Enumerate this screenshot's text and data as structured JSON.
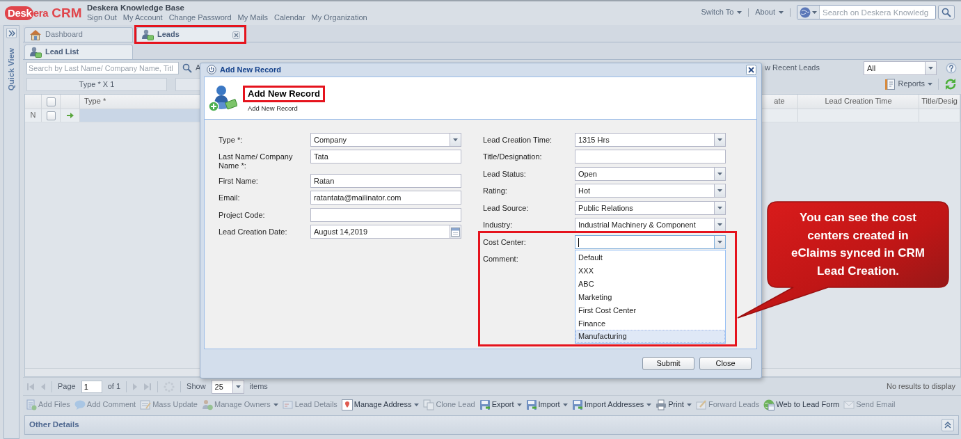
{
  "header": {
    "logo": {
      "mark_text": "Desk",
      "rest_text": "era",
      "product": "CRM"
    },
    "app_title": "Deskera Knowledge Base",
    "links": [
      "Sign Out",
      "My Account",
      "Change Password",
      "My Mails",
      "Calendar",
      "My Organization"
    ],
    "menus": [
      "Switch To",
      "About"
    ],
    "search": {
      "placeholder": "Search on Deskera Knowledg"
    }
  },
  "quick_view": {
    "label": "Quick View"
  },
  "main_tabs": [
    {
      "label": "Dashboard",
      "selected": false,
      "closable": false,
      "highlighted": false
    },
    {
      "label": "Leads",
      "selected": true,
      "closable": true,
      "highlighted": true
    }
  ],
  "sub_tabs": [
    {
      "label": "Lead List",
      "selected": true
    }
  ],
  "list_toolbar": {
    "search_placeholder": "Search by Last Name/ Company Name, Titl",
    "cut_button": "A",
    "recent_button": "w Recent Leads",
    "recent_filter": "All"
  },
  "group_bar": {
    "group_label": "Type * X 1",
    "reports": "Reports"
  },
  "grid": {
    "all_checked": false,
    "columns": [
      {
        "label": "Type *"
      },
      {
        "label": "ate"
      },
      {
        "label": "Lead Creation Time"
      },
      {
        "label": "Title/Desig"
      }
    ],
    "rows": [
      {
        "number": "N",
        "checked": false
      }
    ]
  },
  "pager": {
    "page_label": "Page",
    "page": "1",
    "of_label": "of 1",
    "show_label": "Show",
    "page_size": "25",
    "items_label": "items",
    "status": "No results to display"
  },
  "actions": [
    {
      "label": "Add Files",
      "disabled": true,
      "menu": false
    },
    {
      "label": "Add Comment",
      "disabled": true,
      "menu": false
    },
    {
      "label": "Mass Update",
      "disabled": true,
      "menu": false
    },
    {
      "label": "Manage Owners",
      "disabled": true,
      "menu": true
    },
    {
      "label": "Lead Details",
      "disabled": true,
      "menu": false
    },
    {
      "label": "Manage Address",
      "disabled": false,
      "menu": true
    },
    {
      "label": "Clone Lead",
      "disabled": true,
      "menu": false
    },
    {
      "label": "Export",
      "disabled": false,
      "menu": true
    },
    {
      "label": "Import",
      "disabled": false,
      "menu": true
    },
    {
      "label": "Import Addresses",
      "disabled": false,
      "menu": true
    },
    {
      "label": "Print",
      "disabled": false,
      "menu": true
    },
    {
      "label": "Forward Leads",
      "disabled": true,
      "menu": false
    },
    {
      "label": "Web to Lead Form",
      "disabled": false,
      "menu": false
    },
    {
      "label": "Send Email",
      "disabled": true,
      "menu": false
    }
  ],
  "other_details": {
    "title": "Other Details"
  },
  "dialog": {
    "title": "Add New Record",
    "heading": "Add New Record",
    "heading_highlighted": true,
    "subheading": "Add New Record",
    "left_fields": [
      {
        "label": "Type *:",
        "kind": "combo",
        "value": "Company",
        "focused": false,
        "highlighted": false
      },
      {
        "label": "Last Name/ Company Name *:",
        "kind": "text",
        "value": "Tata",
        "focused": false,
        "highlighted": false
      },
      {
        "label": "First Name:",
        "kind": "text",
        "value": "Ratan",
        "focused": false,
        "highlighted": false
      },
      {
        "label": "Email:",
        "kind": "text",
        "value": "ratantata@mailinator.com",
        "focused": false,
        "highlighted": false
      },
      {
        "label": "Project Code:",
        "kind": "text",
        "focused": false,
        "highlighted": false
      },
      {
        "label": "Lead Creation Date:",
        "kind": "date",
        "value": "August 14,2019",
        "focused": false,
        "highlighted": false
      }
    ],
    "right_fields": [
      {
        "label": "Lead Creation Time:",
        "kind": "combo",
        "value": "1315 Hrs",
        "focused": false,
        "highlighted": false
      },
      {
        "label": "Title/Designation:",
        "kind": "text",
        "focused": false,
        "highlighted": false
      },
      {
        "label": "Lead Status:",
        "kind": "combo",
        "value": "Open",
        "focused": false,
        "highlighted": false
      },
      {
        "label": "Rating:",
        "kind": "combo",
        "value": "Hot",
        "focused": false,
        "highlighted": false
      },
      {
        "label": "Lead Source:",
        "kind": "combo",
        "value": "Public Relations",
        "focused": false,
        "highlighted": false
      },
      {
        "label": "Industry:",
        "kind": "combo",
        "value": "Industrial Machinery & Component",
        "focused": false,
        "highlighted": false
      },
      {
        "label": "Cost Center:",
        "kind": "combo",
        "focused": true,
        "highlighted": true,
        "options": [
          {
            "label": "Default",
            "selected": false
          },
          {
            "label": "XXX",
            "selected": false
          },
          {
            "label": "ABC",
            "selected": false
          },
          {
            "label": "Marketing",
            "selected": false
          },
          {
            "label": "First Cost Center",
            "selected": false
          },
          {
            "label": "Finance",
            "selected": false
          },
          {
            "label": "Manufacturing",
            "selected": true
          }
        ]
      },
      {
        "label": "Comment:",
        "kind": "label",
        "highlighted": false
      }
    ],
    "buttons": [
      "Submit",
      "Close"
    ]
  },
  "callout": {
    "text": "You can see the cost\ncenters created in\neClaims synced in CRM\nLead Creation."
  }
}
